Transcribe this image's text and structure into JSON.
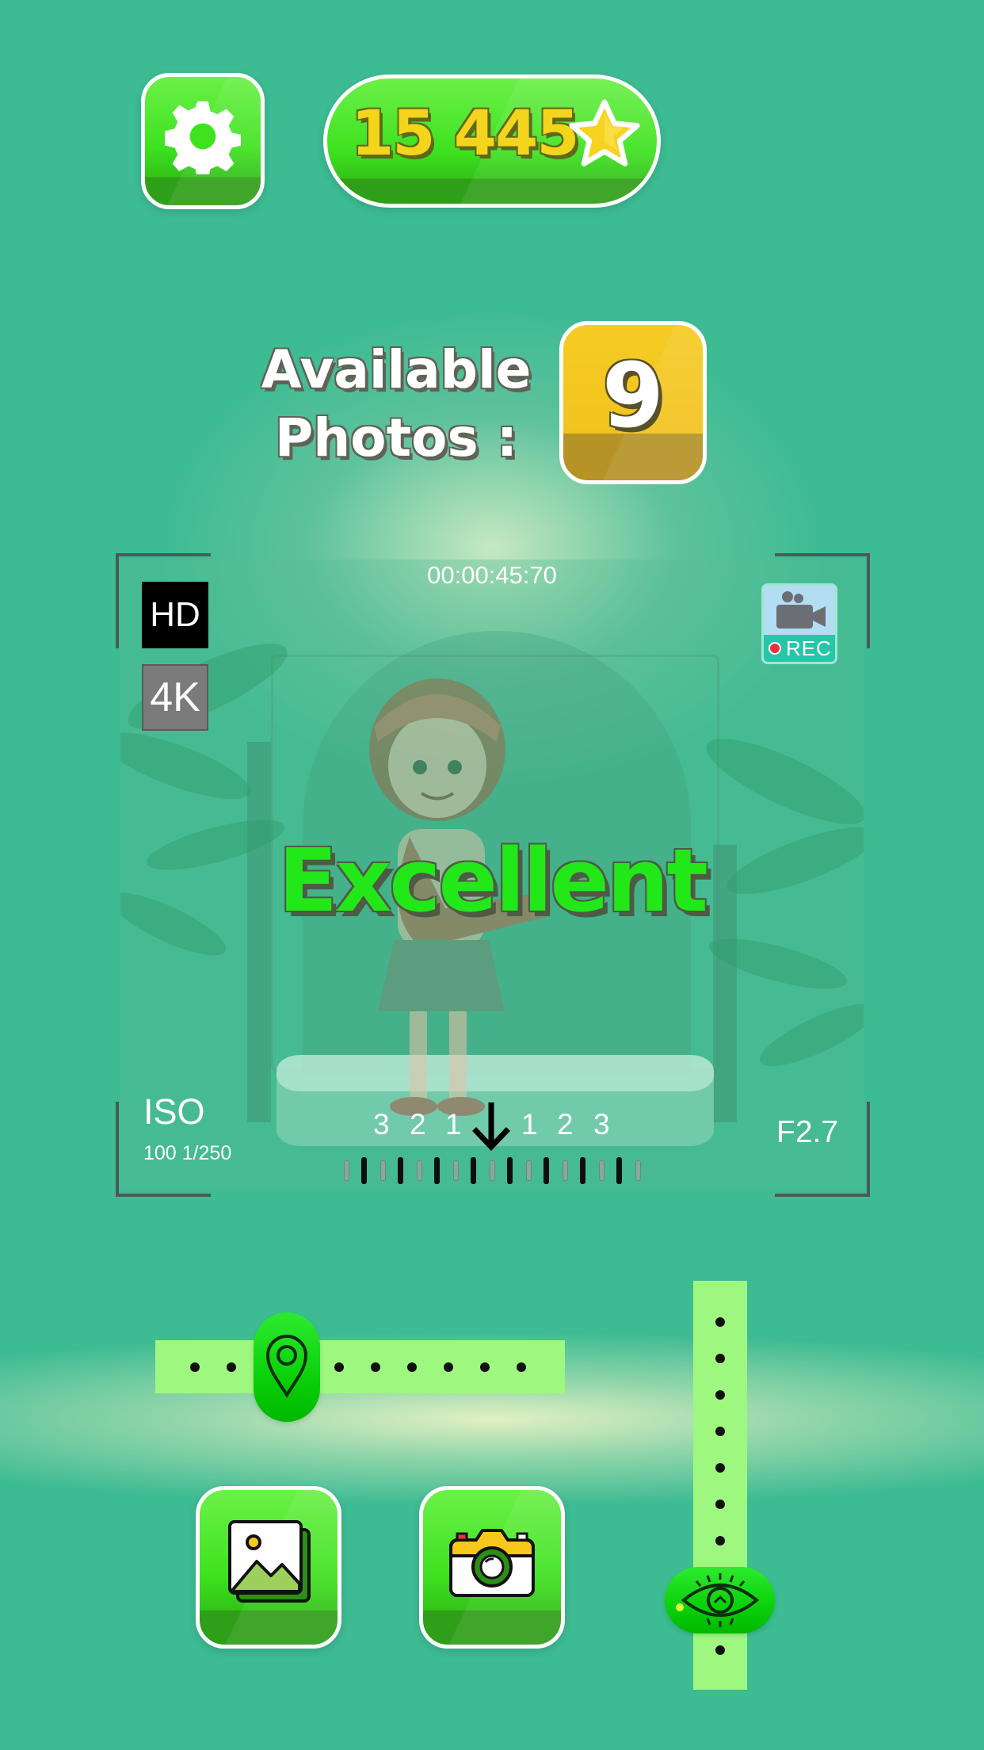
{
  "hud": {
    "score": "15 445",
    "icons": {
      "settings": "gear-icon",
      "score": "star-icon"
    }
  },
  "photos": {
    "label_line1": "Available",
    "label_line2": "Photos :",
    "count": "9"
  },
  "viewfinder": {
    "timer": "00:00:45:70",
    "quality_options": [
      "HD",
      "4K"
    ],
    "selected_quality": "HD",
    "rec_label": "REC",
    "rating": "Excellent",
    "iso_label": "ISO",
    "iso_value": "100 1/250",
    "aperture": "F2.7",
    "scale_left": [
      "3",
      "2",
      "1"
    ],
    "scale_right": [
      "1",
      "2",
      "3"
    ]
  },
  "controls": {
    "gallery_icon": "gallery-icon",
    "capture_icon": "camera-icon",
    "horizontal_slider_icon": "location-pin-icon",
    "vertical_slider_icon": "eye-icon"
  },
  "colors": {
    "background": "#3dbb93",
    "button_green": "#3ee21f",
    "score_yellow": "#f5d41c",
    "count_yellow": "#f2c31e",
    "slider_track": "#9ef77f",
    "rating_green": "#22e81a"
  }
}
